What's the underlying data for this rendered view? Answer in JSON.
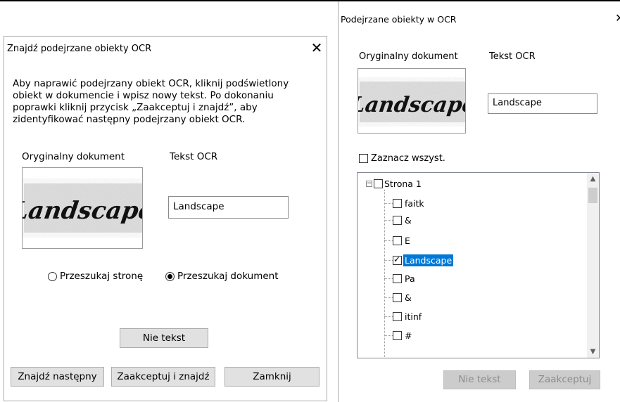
{
  "left_dialog": {
    "title": "Znajdź podejrzane obiekty OCR",
    "intro_lines": [
      "Aby naprawić podejrzany obiekt OCR, kliknij podświetlony",
      "obiekt w dokumencie i wpisz nowy tekst. Po dokonaniu",
      "poprawki kliknij przycisk „Zaakceptuj i znajdź”, aby",
      "zidentyfikować następny podejrzany obiekt OCR."
    ],
    "original_label": "Oryginalny dokument",
    "ocr_label": "Tekst OCR",
    "image_word": "Landscape",
    "ocr_value": "Landscape",
    "radio_page": "Przeszukaj stronę",
    "radio_document": "Przeszukaj dokument",
    "radio_selected": "document",
    "not_text_button": "Nie tekst",
    "find_next_button": "Znajdź następny",
    "accept_find_button": "Zaakceptuj i znajdź",
    "close_button": "Zamknij"
  },
  "right_dialog": {
    "title": "Podejrzane obiekty w OCR",
    "original_label": "Oryginalny dokument",
    "ocr_label": "Tekst OCR",
    "image_word": "Landscape",
    "ocr_value": "Landscape",
    "select_all": "Zaznacz wszyst.",
    "tree_root": "Strona 1",
    "tree_items": [
      {
        "label": "faitk",
        "checked": false,
        "selected": false
      },
      {
        "label": "&",
        "checked": false,
        "selected": false
      },
      {
        "label": "E",
        "checked": false,
        "selected": false
      },
      {
        "label": "Landscape",
        "checked": true,
        "selected": true
      },
      {
        "label": "Pa",
        "checked": false,
        "selected": false
      },
      {
        "label": "&",
        "checked": false,
        "selected": false
      },
      {
        "label": "itinf",
        "checked": false,
        "selected": false
      },
      {
        "label": "#",
        "checked": false,
        "selected": false
      }
    ],
    "not_text_button": "Nie tekst",
    "accept_button": "Zaakceptuj"
  }
}
